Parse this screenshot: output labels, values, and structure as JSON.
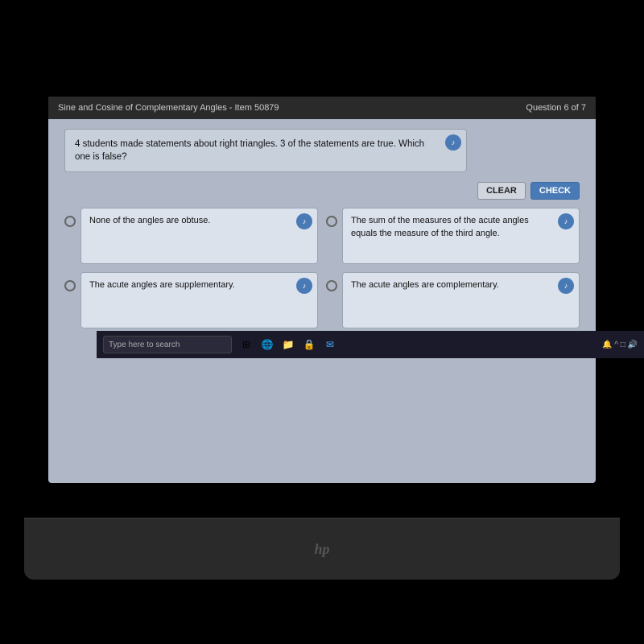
{
  "header": {
    "title": "Sine and Cosine of Complementary Angles - Item 50879",
    "question_count": "Question 6 of 7"
  },
  "question": {
    "text": "4 students made statements about right triangles. 3 of the statements are true. Which one is false?",
    "audio_icon": "♪"
  },
  "buttons": {
    "clear_label": "CLEAR",
    "check_label": "CHECK"
  },
  "options": [
    {
      "id": "A",
      "text": "None of the angles are obtuse."
    },
    {
      "id": "B",
      "text": "The sum of the measures of the acute angles equals the measure of the third angle."
    },
    {
      "id": "C",
      "text": "The acute angles are supplementary."
    },
    {
      "id": "D",
      "text": "The acute angles are complementary."
    }
  ],
  "taskbar": {
    "search_placeholder": "Type here to search",
    "icons": [
      "⊞",
      "🌐",
      "📁",
      "🔒",
      "✉"
    ],
    "right_icons": [
      "🔔",
      "^",
      "□",
      "🔊"
    ]
  },
  "hp_logo": "hp"
}
